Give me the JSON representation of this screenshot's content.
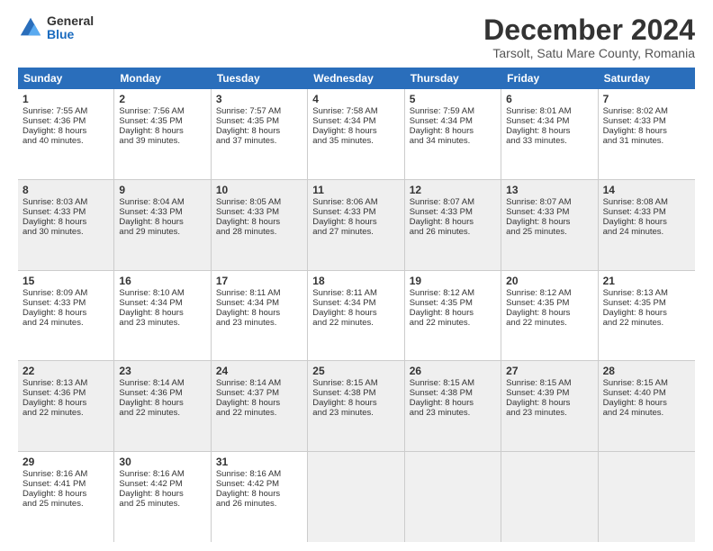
{
  "logo": {
    "general": "General",
    "blue": "Blue"
  },
  "title": "December 2024",
  "subtitle": "Tarsolt, Satu Mare County, Romania",
  "header_days": [
    "Sunday",
    "Monday",
    "Tuesday",
    "Wednesday",
    "Thursday",
    "Friday",
    "Saturday"
  ],
  "weeks": [
    [
      {
        "day": "1",
        "lines": [
          "Sunrise: 7:55 AM",
          "Sunset: 4:36 PM",
          "Daylight: 8 hours",
          "and 40 minutes."
        ]
      },
      {
        "day": "2",
        "lines": [
          "Sunrise: 7:56 AM",
          "Sunset: 4:35 PM",
          "Daylight: 8 hours",
          "and 39 minutes."
        ]
      },
      {
        "day": "3",
        "lines": [
          "Sunrise: 7:57 AM",
          "Sunset: 4:35 PM",
          "Daylight: 8 hours",
          "and 37 minutes."
        ]
      },
      {
        "day": "4",
        "lines": [
          "Sunrise: 7:58 AM",
          "Sunset: 4:34 PM",
          "Daylight: 8 hours",
          "and 35 minutes."
        ]
      },
      {
        "day": "5",
        "lines": [
          "Sunrise: 7:59 AM",
          "Sunset: 4:34 PM",
          "Daylight: 8 hours",
          "and 34 minutes."
        ]
      },
      {
        "day": "6",
        "lines": [
          "Sunrise: 8:01 AM",
          "Sunset: 4:34 PM",
          "Daylight: 8 hours",
          "and 33 minutes."
        ]
      },
      {
        "day": "7",
        "lines": [
          "Sunrise: 8:02 AM",
          "Sunset: 4:33 PM",
          "Daylight: 8 hours",
          "and 31 minutes."
        ]
      }
    ],
    [
      {
        "day": "8",
        "lines": [
          "Sunrise: 8:03 AM",
          "Sunset: 4:33 PM",
          "Daylight: 8 hours",
          "and 30 minutes."
        ]
      },
      {
        "day": "9",
        "lines": [
          "Sunrise: 8:04 AM",
          "Sunset: 4:33 PM",
          "Daylight: 8 hours",
          "and 29 minutes."
        ]
      },
      {
        "day": "10",
        "lines": [
          "Sunrise: 8:05 AM",
          "Sunset: 4:33 PM",
          "Daylight: 8 hours",
          "and 28 minutes."
        ]
      },
      {
        "day": "11",
        "lines": [
          "Sunrise: 8:06 AM",
          "Sunset: 4:33 PM",
          "Daylight: 8 hours",
          "and 27 minutes."
        ]
      },
      {
        "day": "12",
        "lines": [
          "Sunrise: 8:07 AM",
          "Sunset: 4:33 PM",
          "Daylight: 8 hours",
          "and 26 minutes."
        ]
      },
      {
        "day": "13",
        "lines": [
          "Sunrise: 8:07 AM",
          "Sunset: 4:33 PM",
          "Daylight: 8 hours",
          "and 25 minutes."
        ]
      },
      {
        "day": "14",
        "lines": [
          "Sunrise: 8:08 AM",
          "Sunset: 4:33 PM",
          "Daylight: 8 hours",
          "and 24 minutes."
        ]
      }
    ],
    [
      {
        "day": "15",
        "lines": [
          "Sunrise: 8:09 AM",
          "Sunset: 4:33 PM",
          "Daylight: 8 hours",
          "and 24 minutes."
        ]
      },
      {
        "day": "16",
        "lines": [
          "Sunrise: 8:10 AM",
          "Sunset: 4:34 PM",
          "Daylight: 8 hours",
          "and 23 minutes."
        ]
      },
      {
        "day": "17",
        "lines": [
          "Sunrise: 8:11 AM",
          "Sunset: 4:34 PM",
          "Daylight: 8 hours",
          "and 23 minutes."
        ]
      },
      {
        "day": "18",
        "lines": [
          "Sunrise: 8:11 AM",
          "Sunset: 4:34 PM",
          "Daylight: 8 hours",
          "and 22 minutes."
        ]
      },
      {
        "day": "19",
        "lines": [
          "Sunrise: 8:12 AM",
          "Sunset: 4:35 PM",
          "Daylight: 8 hours",
          "and 22 minutes."
        ]
      },
      {
        "day": "20",
        "lines": [
          "Sunrise: 8:12 AM",
          "Sunset: 4:35 PM",
          "Daylight: 8 hours",
          "and 22 minutes."
        ]
      },
      {
        "day": "21",
        "lines": [
          "Sunrise: 8:13 AM",
          "Sunset: 4:35 PM",
          "Daylight: 8 hours",
          "and 22 minutes."
        ]
      }
    ],
    [
      {
        "day": "22",
        "lines": [
          "Sunrise: 8:13 AM",
          "Sunset: 4:36 PM",
          "Daylight: 8 hours",
          "and 22 minutes."
        ]
      },
      {
        "day": "23",
        "lines": [
          "Sunrise: 8:14 AM",
          "Sunset: 4:36 PM",
          "Daylight: 8 hours",
          "and 22 minutes."
        ]
      },
      {
        "day": "24",
        "lines": [
          "Sunrise: 8:14 AM",
          "Sunset: 4:37 PM",
          "Daylight: 8 hours",
          "and 22 minutes."
        ]
      },
      {
        "day": "25",
        "lines": [
          "Sunrise: 8:15 AM",
          "Sunset: 4:38 PM",
          "Daylight: 8 hours",
          "and 23 minutes."
        ]
      },
      {
        "day": "26",
        "lines": [
          "Sunrise: 8:15 AM",
          "Sunset: 4:38 PM",
          "Daylight: 8 hours",
          "and 23 minutes."
        ]
      },
      {
        "day": "27",
        "lines": [
          "Sunrise: 8:15 AM",
          "Sunset: 4:39 PM",
          "Daylight: 8 hours",
          "and 23 minutes."
        ]
      },
      {
        "day": "28",
        "lines": [
          "Sunrise: 8:15 AM",
          "Sunset: 4:40 PM",
          "Daylight: 8 hours",
          "and 24 minutes."
        ]
      }
    ],
    [
      {
        "day": "29",
        "lines": [
          "Sunrise: 8:16 AM",
          "Sunset: 4:41 PM",
          "Daylight: 8 hours",
          "and 25 minutes."
        ]
      },
      {
        "day": "30",
        "lines": [
          "Sunrise: 8:16 AM",
          "Sunset: 4:42 PM",
          "Daylight: 8 hours",
          "and 25 minutes."
        ]
      },
      {
        "day": "31",
        "lines": [
          "Sunrise: 8:16 AM",
          "Sunset: 4:42 PM",
          "Daylight: 8 hours",
          "and 26 minutes."
        ]
      },
      {
        "day": "",
        "lines": []
      },
      {
        "day": "",
        "lines": []
      },
      {
        "day": "",
        "lines": []
      },
      {
        "day": "",
        "lines": []
      }
    ]
  ]
}
